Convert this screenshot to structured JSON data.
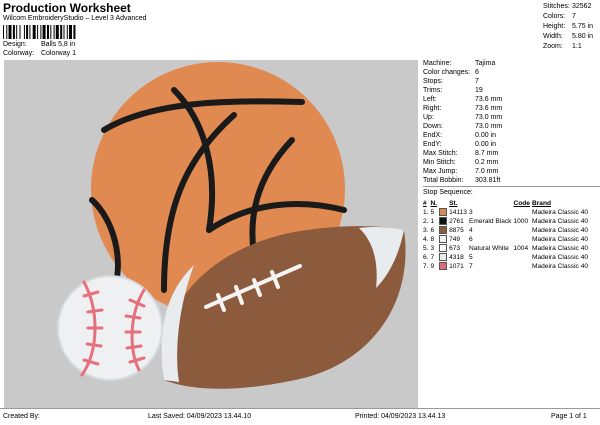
{
  "header": {
    "title": "Production Worksheet",
    "subtitle": "Wilcom EmbroideryStudio – Level 3 Advanced",
    "design_label": "Design:",
    "design_value": "Balls 5,8 in",
    "colorway_label": "Colorway:",
    "colorway_value": "Colorway 1"
  },
  "summary": [
    {
      "label": "Stitches:",
      "value": "32562"
    },
    {
      "label": "Colors:",
      "value": "7"
    },
    {
      "label": "Height:",
      "value": "5.75 in"
    },
    {
      "label": "Width:",
      "value": "5.80 in"
    },
    {
      "label": "Zoom:",
      "value": "1:1"
    }
  ],
  "machine": [
    {
      "label": "Machine:",
      "value": "Tajima"
    },
    {
      "label": "Color changes:",
      "value": "6"
    },
    {
      "label": "Stops:",
      "value": "7"
    },
    {
      "label": "Trims:",
      "value": "19"
    },
    {
      "label": "Left:",
      "value": "73.6 mm"
    },
    {
      "label": "Right:",
      "value": "73.6 mm"
    },
    {
      "label": "Up:",
      "value": "73.0 mm"
    },
    {
      "label": "Down:",
      "value": "73.0 mm"
    },
    {
      "label": "EndX:",
      "value": "0.00 in"
    },
    {
      "label": "EndY:",
      "value": "0.00 in"
    },
    {
      "label": "Max Stitch:",
      "value": "8.7 mm"
    },
    {
      "label": "Min Stitch:",
      "value": "0.2 mm"
    },
    {
      "label": "Max Jump:",
      "value": "7.0 mm"
    },
    {
      "label": "Total Bobbin:",
      "value": "303.81ft"
    }
  ],
  "stop_sequence": {
    "title": "Stop Sequence:",
    "headers": {
      "n": "#",
      "n2": "N.",
      "st": "St.",
      "code": "Code",
      "brand": "Brand"
    },
    "rows": [
      {
        "n": "1.",
        "n2": "5",
        "color": "#d98a50",
        "st": "14113",
        "name": "3",
        "code": "",
        "brand": "Madeira Classic 40"
      },
      {
        "n": "2.",
        "n2": "1",
        "color": "#111111",
        "st": "2761",
        "name": "Emerald Black",
        "code": "1000",
        "brand": "Madeira Classic 40"
      },
      {
        "n": "3.",
        "n2": "6",
        "color": "#8a5a3a",
        "st": "8875",
        "name": "4",
        "code": "",
        "brand": "Madeira Classic 40"
      },
      {
        "n": "4.",
        "n2": "8",
        "color": "#f2f2f2",
        "st": "749",
        "name": "6",
        "code": "",
        "brand": "Madeira Classic 40"
      },
      {
        "n": "5.",
        "n2": "3",
        "color": "#fbfbf5",
        "st": "673",
        "name": "Natural White",
        "code": "1004",
        "brand": "Madeira Classic 40"
      },
      {
        "n": "6.",
        "n2": "7",
        "color": "#e8ecf0",
        "st": "4318",
        "name": "5",
        "code": "",
        "brand": "Madeira Classic 40"
      },
      {
        "n": "7.",
        "n2": "9",
        "color": "#e06a78",
        "st": "1071",
        "name": "7",
        "code": "",
        "brand": "Madeira Classic 40"
      }
    ]
  },
  "footer": {
    "created_by": "Created By:",
    "last_saved": "Last Saved: 04/09/2023 13.44.10",
    "printed": "Printed: 04/09/2023 13.44.13",
    "page": "Page 1 of 1"
  },
  "colors": {
    "design_bg": "#c9c9c9",
    "basketball": "#e08a52",
    "football": "#8c5a3c",
    "baseball": "#eef0f2",
    "laces": "#e6707c"
  }
}
